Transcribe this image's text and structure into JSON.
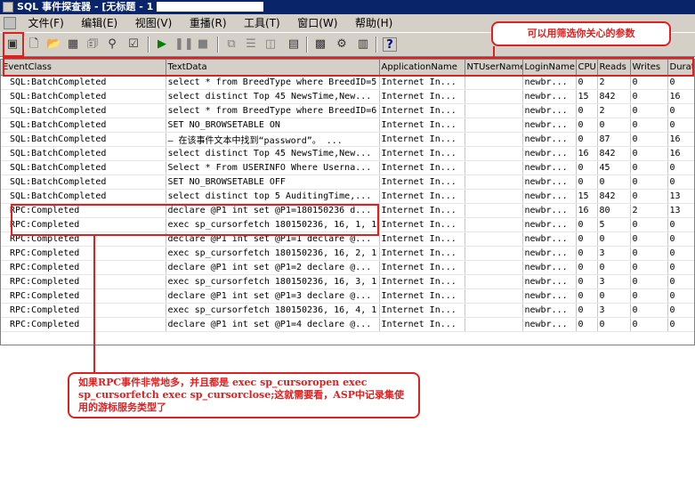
{
  "window": {
    "title": "SQL 事件探查器 - [无标题 - 1"
  },
  "menu": [
    {
      "name": "menu-file",
      "label": "文件(F)"
    },
    {
      "name": "menu-edit",
      "label": "编辑(E)"
    },
    {
      "name": "menu-view",
      "label": "视图(V)"
    },
    {
      "name": "menu-replay",
      "label": "重播(R)"
    },
    {
      "name": "menu-tools",
      "label": "工具(T)"
    },
    {
      "name": "menu-window",
      "label": "窗口(W)"
    },
    {
      "name": "menu-help",
      "label": "帮助(H)"
    }
  ],
  "toolbar_icons": [
    {
      "name": "trace-properties-icon",
      "glyph": "▣"
    },
    {
      "name": "new-trace-icon",
      "glyph": "🗋"
    },
    {
      "name": "open-icon",
      "glyph": "📂"
    },
    {
      "name": "template-icon",
      "glyph": "▦"
    },
    {
      "name": "properties-icon",
      "glyph": "🗊"
    },
    {
      "name": "find-icon",
      "glyph": "⚲"
    },
    {
      "name": "clear-icon",
      "glyph": "☑"
    },
    {
      "name": "start-icon",
      "glyph": "▶"
    },
    {
      "name": "pause-icon",
      "glyph": "❚❚"
    },
    {
      "name": "stop-icon",
      "glyph": "■"
    },
    {
      "name": "cascade-icon",
      "glyph": "⧉"
    },
    {
      "name": "tile-horizontal-icon",
      "glyph": "☰"
    },
    {
      "name": "tile-vertical-icon",
      "glyph": "◫"
    },
    {
      "name": "events-icon",
      "glyph": "▤"
    },
    {
      "name": "query-analyzer-icon",
      "glyph": "▩"
    },
    {
      "name": "tuning-icon",
      "glyph": "⚙"
    },
    {
      "name": "manager-icon",
      "glyph": "▥"
    },
    {
      "name": "help-icon",
      "glyph": "?"
    }
  ],
  "columns": [
    "EventClass",
    "TextData",
    "ApplicationName",
    "NTUserName",
    "LoginName",
    "CPU",
    "Reads",
    "Writes",
    "Durat"
  ],
  "rows": [
    [
      "SQL:BatchCompleted",
      "select * from BreedType where BreedID=5",
      "Internet In...",
      "",
      "newbr...",
      "0",
      "2",
      "0",
      "0"
    ],
    [
      "SQL:BatchCompleted",
      "select distinct Top 45 NewsTime,New...",
      "Internet In...",
      "",
      "newbr...",
      "15",
      "842",
      "0",
      "16"
    ],
    [
      "SQL:BatchCompleted",
      "select * from BreedType where BreedID=6",
      "Internet In...",
      "",
      "newbr...",
      "0",
      "2",
      "0",
      "0"
    ],
    [
      "SQL:BatchCompleted",
      "SET NO_BROWSETABLE ON",
      "Internet In...",
      "",
      "newbr...",
      "0",
      "0",
      "0",
      "0"
    ],
    [
      "SQL:BatchCompleted",
      "— 在该事件文本中找到“password”。 ...",
      "Internet In...",
      "",
      "newbr...",
      "0",
      "87",
      "0",
      "16"
    ],
    [
      "SQL:BatchCompleted",
      "select distinct Top 45 NewsTime,New...",
      "Internet In...",
      "",
      "newbr...",
      "16",
      "842",
      "0",
      "16"
    ],
    [
      "SQL:BatchCompleted",
      "Select * From USERINFO Where Userna...",
      "Internet In...",
      "",
      "newbr...",
      "0",
      "45",
      "0",
      "0"
    ],
    [
      "SQL:BatchCompleted",
      "SET NO_BROWSETABLE OFF",
      "Internet In...",
      "",
      "newbr...",
      "0",
      "0",
      "0",
      "0"
    ],
    [
      "SQL:BatchCompleted",
      "select distinct top 5 AuditingTime,...",
      "Internet In...",
      "",
      "newbr...",
      "15",
      "842",
      "0",
      "13"
    ],
    [
      "RPC:Completed",
      "declare @P1 int set @P1=180150236 d...",
      "Internet In...",
      "",
      "newbr...",
      "16",
      "80",
      "2",
      "13"
    ],
    [
      "RPC:Completed",
      "exec sp_cursorfetch 180150236, 16, 1, 1",
      "Internet In...",
      "",
      "newbr...",
      "0",
      "5",
      "0",
      "0"
    ],
    [
      "RPC:Completed",
      "declare @P1 int set @P1=1 declare @...",
      "Internet In...",
      "",
      "newbr...",
      "0",
      "0",
      "0",
      "0"
    ],
    [
      "RPC:Completed",
      "exec sp_cursorfetch 180150236, 16, 2, 1",
      "Internet In...",
      "",
      "newbr...",
      "0",
      "3",
      "0",
      "0"
    ],
    [
      "RPC:Completed",
      "declare @P1 int set @P1=2 declare @...",
      "Internet In...",
      "",
      "newbr...",
      "0",
      "0",
      "0",
      "0"
    ],
    [
      "RPC:Completed",
      "exec sp_cursorfetch 180150236, 16, 3, 1",
      "Internet In...",
      "",
      "newbr...",
      "0",
      "3",
      "0",
      "0"
    ],
    [
      "RPC:Completed",
      "declare @P1 int set @P1=3 declare @...",
      "Internet In...",
      "",
      "newbr...",
      "0",
      "0",
      "0",
      "0"
    ],
    [
      "RPC:Completed",
      "exec sp_cursorfetch 180150236, 16, 4, 1",
      "Internet In...",
      "",
      "newbr...",
      "0",
      "3",
      "0",
      "0"
    ],
    [
      "RPC:Completed",
      "declare @P1 int set @P1=4 declare @...",
      "Internet In...",
      "",
      "newbr...",
      "0",
      "0",
      "0",
      "0"
    ]
  ],
  "annotations": {
    "top_callout": "可以用筛选你关心的参数",
    "bottom_callout": "如果RPC事件非常地多，并且都是 exec sp_cursoropen exec sp_cursorfetch exec sp_cursorclose;这就需要看，ASP中记录集使用的游标服务类型了"
  }
}
